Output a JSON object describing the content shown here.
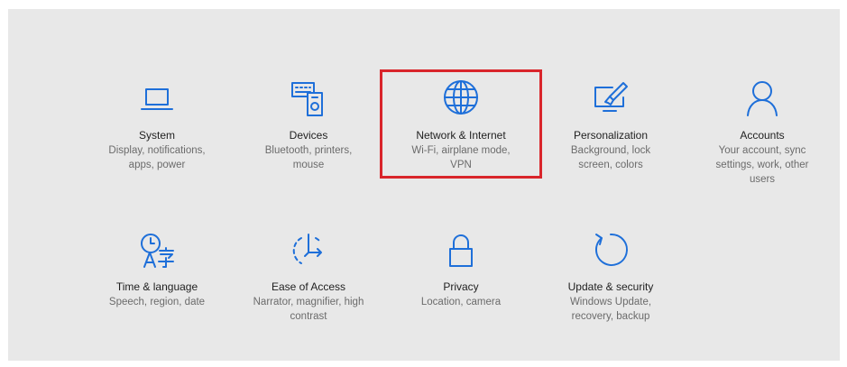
{
  "accent_color": "#1e6fd9",
  "highlight_color": "#d9252b",
  "tiles": [
    {
      "title": "System",
      "desc": "Display, notifications, apps, power",
      "icon": "laptop-icon"
    },
    {
      "title": "Devices",
      "desc": "Bluetooth, printers, mouse",
      "icon": "devices-icon"
    },
    {
      "title": "Network & Internet",
      "desc": "Wi-Fi, airplane mode, VPN",
      "icon": "globe-icon"
    },
    {
      "title": "Personalization",
      "desc": "Background, lock screen, colors",
      "icon": "paintbrush-icon"
    },
    {
      "title": "Accounts",
      "desc": "Your account, sync settings, work, other users",
      "icon": "person-icon"
    },
    {
      "title": "Time & language",
      "desc": "Speech, region, date",
      "icon": "time-language-icon"
    },
    {
      "title": "Ease of Access",
      "desc": "Narrator, magnifier, high contrast",
      "icon": "ease-of-access-icon"
    },
    {
      "title": "Privacy",
      "desc": "Location, camera",
      "icon": "lock-icon"
    },
    {
      "title": "Update & security",
      "desc": "Windows Update, recovery, backup",
      "icon": "refresh-icon"
    }
  ]
}
